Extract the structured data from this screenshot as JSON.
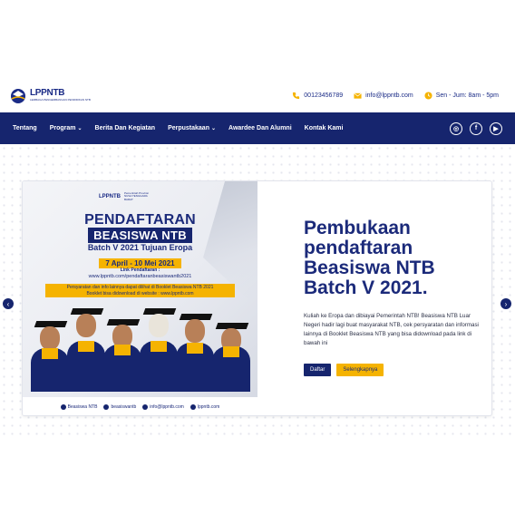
{
  "header": {
    "logo": {
      "name": "LPPNTB",
      "tagline": "LEMBAGA PENGEMBANGAN PENDIDIKAN NTB"
    },
    "contacts": [
      {
        "icon": "phone-icon",
        "text": "00123456789"
      },
      {
        "icon": "mail-icon",
        "text": "info@lppntb.com"
      },
      {
        "icon": "clock-icon",
        "text": "Sen - Jum: 8am - 5pm"
      }
    ]
  },
  "nav": {
    "items": [
      {
        "label": "Tentang",
        "dropdown": false
      },
      {
        "label": "Program",
        "dropdown": true
      },
      {
        "label": "Berita Dan Kegiatan",
        "dropdown": false
      },
      {
        "label": "Perpustakaan",
        "dropdown": true
      },
      {
        "label": "Awardee Dan Alumni",
        "dropdown": false
      },
      {
        "label": "Kontak Kami",
        "dropdown": false
      }
    ],
    "socials": [
      {
        "icon": "instagram-icon",
        "glyph": "◎"
      },
      {
        "icon": "facebook-icon",
        "glyph": "f"
      },
      {
        "icon": "youtube-icon",
        "glyph": "▶"
      }
    ]
  },
  "slider": {
    "poster": {
      "logo_name": "LPPNTB",
      "gov_text": "Pemerintah Provinsi NUSA TENGGARA BARAT",
      "title": "PENDAFTARAN",
      "subtitle": "BEASISWA NTB",
      "batch": "Batch V 2021 Tujuan Eropa",
      "date": "7 April - 10 Mei 2021",
      "link_label": "Link Pendaftaran :",
      "link": "www.lppntb.com/pendaftaranbeasiswantb2021",
      "note_line1": "Persyaratan dan info lainnya dapat dilihat di Booklet Beasiswa NTB 2021",
      "note_line2": "Booklet bisa didownload di website : www.lppntb.com",
      "footer": [
        {
          "icon": "facebook-icon",
          "text": "Beasiswa NTB"
        },
        {
          "icon": "instagram-icon",
          "text": "beasiswantb"
        },
        {
          "icon": "mail-icon",
          "text": "info@lppntb.com"
        },
        {
          "icon": "globe-icon",
          "text": "lppntb.com"
        }
      ]
    },
    "title": "Pembukaan pendaftaran Beasiswa NTB Batch V 2021.",
    "description": "Kuliah ke Eropa dan dibiayai Pemerintah NTB! Beasiswa NTB Luar Negeri hadir lagi buat masyarakat NTB, cek persyaratan dan informasi lainnya di Booklet Beasiswa NTB yang bisa didownload pada link di bawah ini",
    "buttons": {
      "primary": "Daftar",
      "secondary": "Selengkapnya"
    },
    "prev_glyph": "‹",
    "next_glyph": "›"
  },
  "colors": {
    "primary": "#16256e",
    "accent": "#f5b301"
  }
}
